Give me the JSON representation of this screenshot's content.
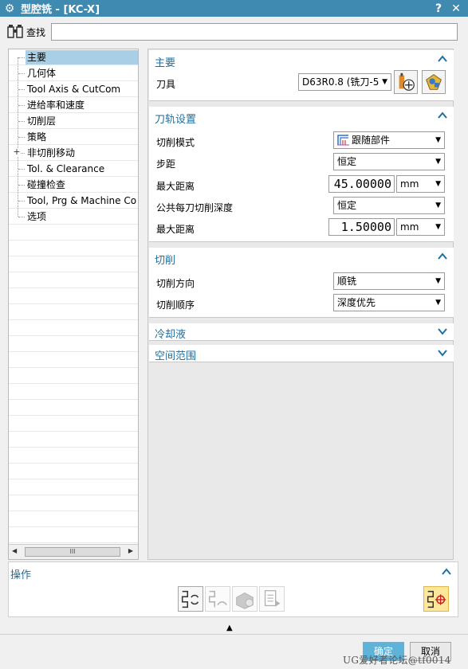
{
  "window": {
    "title": "型腔铣 - [KC-X]",
    "help_label": "?",
    "close_label": "✕"
  },
  "search": {
    "label": "查找",
    "value": ""
  },
  "tree": {
    "items": [
      {
        "label": "主要",
        "selected": true,
        "expandable": false
      },
      {
        "label": "几何体",
        "selected": false,
        "expandable": false
      },
      {
        "label": "Tool Axis & CutCom",
        "selected": false,
        "expandable": false
      },
      {
        "label": "进给率和速度",
        "selected": false,
        "expandable": false
      },
      {
        "label": "切削层",
        "selected": false,
        "expandable": false
      },
      {
        "label": "策略",
        "selected": false,
        "expandable": false
      },
      {
        "label": "非切削移动",
        "selected": false,
        "expandable": true
      },
      {
        "label": "Tol. & Clearance",
        "selected": false,
        "expandable": false
      },
      {
        "label": "碰撞检查",
        "selected": false,
        "expandable": false
      },
      {
        "label": "Tool, Prg & Machine Co",
        "selected": false,
        "expandable": false
      },
      {
        "label": "选项",
        "selected": false,
        "expandable": false
      }
    ],
    "expand_glyph": "+",
    "scroll_left": "◀",
    "scroll_right": "▶",
    "scroll_thumb": "III"
  },
  "main": {
    "title": "主要",
    "tool_label": "刀具",
    "tool_value": "D63R0.8 (铣刀-5"
  },
  "toolpath": {
    "title": "刀轨设置",
    "cut_pattern_label": "切削模式",
    "cut_pattern_value": "跟随部件",
    "stepover_label": "步距",
    "stepover_value": "恒定",
    "max_distance_label": "最大距离",
    "max_distance_value": "45.00000",
    "max_distance_unit": "mm",
    "common_depth_label": "公共每刀切削深度",
    "common_depth_value": "恒定",
    "max_distance2_label": "最大距离",
    "max_distance2_value": "1.50000",
    "max_distance2_unit": "mm"
  },
  "cutting": {
    "title": "切削",
    "direction_label": "切削方向",
    "direction_value": "顺铣",
    "order_label": "切削顺序",
    "order_value": "深度优先"
  },
  "coolant": {
    "title": "冷却液"
  },
  "space": {
    "title": "空间范围"
  },
  "operations": {
    "title": "操作"
  },
  "buttons": {
    "ok": "确定",
    "cancel": "取消",
    "collapse": "▲"
  },
  "watermark": "UG爱好者论坛@tf0014",
  "colors": {
    "titlebar": "#3f8ab1",
    "section_title": "#1b6fa1",
    "ok_button": "#5fb3d9",
    "selected_item": "#a9cfe6"
  }
}
